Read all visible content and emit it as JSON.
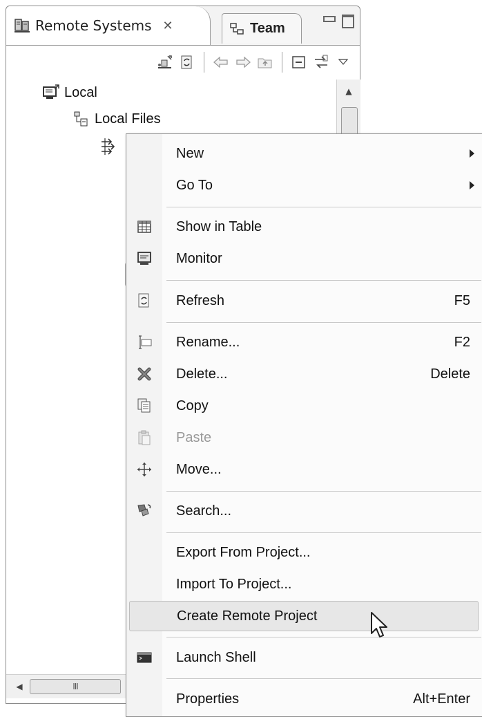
{
  "view": {
    "tabs": [
      {
        "label": "Remote Systems",
        "close": "✕",
        "icon": "remote-systems-icon"
      },
      {
        "label": "Team",
        "icon": "team-icon"
      }
    ],
    "window_buttons": [
      "minimize-icon",
      "maximize-icon"
    ],
    "toolbar_icons": [
      "new-connection-icon",
      "refresh-icon",
      "back-arrow-icon",
      "forward-arrow-icon",
      "up-folder-icon",
      "collapse-all-icon",
      "link-with-editor-icon",
      "view-menu-icon"
    ]
  },
  "tree": {
    "items": [
      {
        "label": "Local",
        "icon": "local-host-icon"
      },
      {
        "label": "Local Files",
        "icon": "local-files-icon"
      },
      {
        "label": "",
        "icon": "subsystem-icon"
      }
    ]
  },
  "scrollbar": {
    "h_grip": "III"
  },
  "context_menu": {
    "items": [
      {
        "label": "New",
        "submenu": true
      },
      {
        "label": "Go To",
        "submenu": true
      },
      {
        "label": "Show in Table",
        "icon": "table-icon"
      },
      {
        "label": "Monitor",
        "icon": "monitor-icon"
      },
      {
        "label": "Refresh",
        "accel": "F5",
        "icon": "refresh-icon"
      },
      {
        "label": "Rename...",
        "accel": "F2",
        "icon": "rename-icon"
      },
      {
        "label": "Delete...",
        "accel": "Delete",
        "icon": "delete-icon"
      },
      {
        "label": "Copy",
        "icon": "copy-icon"
      },
      {
        "label": "Paste",
        "icon": "paste-icon",
        "disabled": true
      },
      {
        "label": "Move...",
        "icon": "move-icon"
      },
      {
        "label": "Search...",
        "icon": "search-icon"
      },
      {
        "label": "Export From Project..."
      },
      {
        "label": "Import To Project..."
      },
      {
        "label": "Create Remote Project",
        "highlighted": true
      },
      {
        "label": "Launch Shell",
        "icon": "shell-icon"
      },
      {
        "label": "Properties",
        "accel": "Alt+Enter"
      }
    ]
  }
}
